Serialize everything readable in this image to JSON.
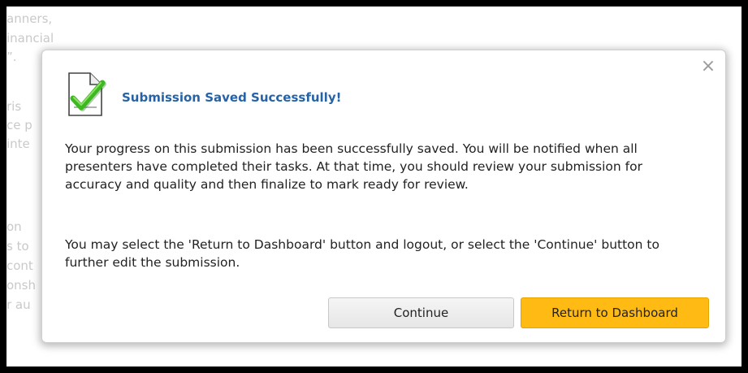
{
  "background": {
    "fragments": [
      "anners,",
      "inancial",
      "”.",
      "ris",
      "ce p",
      "inte",
      "on",
      "s to",
      "cont",
      "onsh",
      "r au"
    ]
  },
  "dialog": {
    "title": "Submission Saved Successfully!",
    "message_1": "Your progress on this submission has been successfully saved. You will be notified when all presenters have completed their tasks. At that time, you should review your submission for accuracy and quality and then finalize to mark ready for review.",
    "message_2": "You may select the 'Return to Dashboard' button and logout, or select the 'Continue' button to further edit the submission.",
    "close_symbol": "×",
    "continue_label": "Continue",
    "dashboard_label": "Return to Dashboard",
    "icon": "document-check-icon"
  },
  "colors": {
    "title": "#2563a6",
    "primary_button": "#ffba14",
    "check": "#3cb820"
  }
}
